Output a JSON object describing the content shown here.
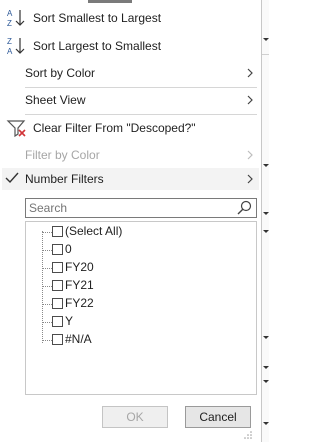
{
  "menu": {
    "sort_asc": "Sort Smallest to Largest",
    "sort_desc": "Sort Largest to Smallest",
    "sort_by_color": "Sort by Color",
    "sheet_view": "Sheet View",
    "clear_filter": "Clear Filter From \"Descoped?\"",
    "filter_by_color": "Filter by Color",
    "number_filters": "Number Filters"
  },
  "search": {
    "placeholder": "Search"
  },
  "list": {
    "items": [
      "(Select All)",
      "0",
      "FY20",
      "FY21",
      "FY22",
      "Y",
      "#N/A"
    ]
  },
  "buttons": {
    "ok": "OK",
    "cancel": "Cancel"
  },
  "colors": {
    "accent_blue": "#2b5797",
    "clear_red": "#d13438",
    "disabled": "#a6a6a6"
  },
  "icons": [
    "sort-ascending-icon",
    "sort-descending-icon",
    "clear-filter-icon",
    "checkmark-icon",
    "search-icon",
    "chevron-right-icon",
    "resize-grip-icon"
  ]
}
